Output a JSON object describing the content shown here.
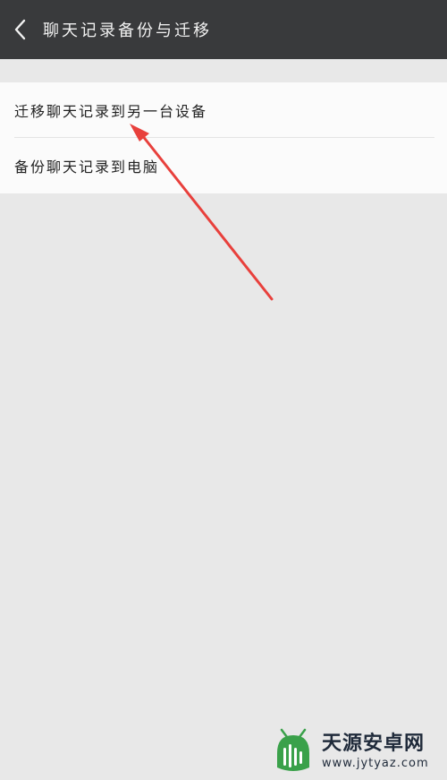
{
  "header": {
    "title": "聊天记录备份与迁移",
    "back_icon": "chevron-left-icon"
  },
  "menu": {
    "items": [
      {
        "label": "迁移聊天记录到另一台设备"
      },
      {
        "label": "备份聊天记录到电脑"
      }
    ]
  },
  "annotation": {
    "arrow_color": "#e8403c"
  },
  "watermark": {
    "name": "天源安卓网",
    "url": "www.jytyaz.com"
  },
  "colors": {
    "header_bg": "#393a3c",
    "page_bg": "#e8e8e8",
    "card_bg": "#fbfbfb",
    "brand_green": "#3aa14a"
  }
}
